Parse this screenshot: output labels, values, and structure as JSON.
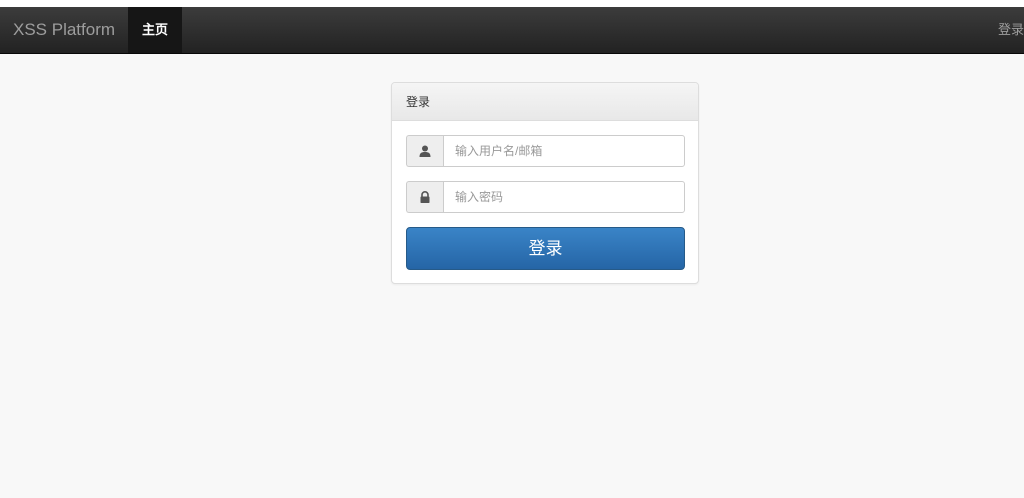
{
  "navbar": {
    "brand": "XSS Platform",
    "home_label": "主页",
    "login_label": "登录"
  },
  "panel": {
    "heading": "登录",
    "username": {
      "icon": "user-icon",
      "placeholder": "输入用户名/邮箱",
      "value": ""
    },
    "password": {
      "icon": "lock-icon",
      "placeholder": "输入密码",
      "value": ""
    },
    "submit_label": "登录"
  },
  "colors": {
    "navbar_bg": "#222222",
    "active_nav_bg": "#161616",
    "page_bg": "#f8f8f8",
    "primary_button": "#2d75b9"
  }
}
